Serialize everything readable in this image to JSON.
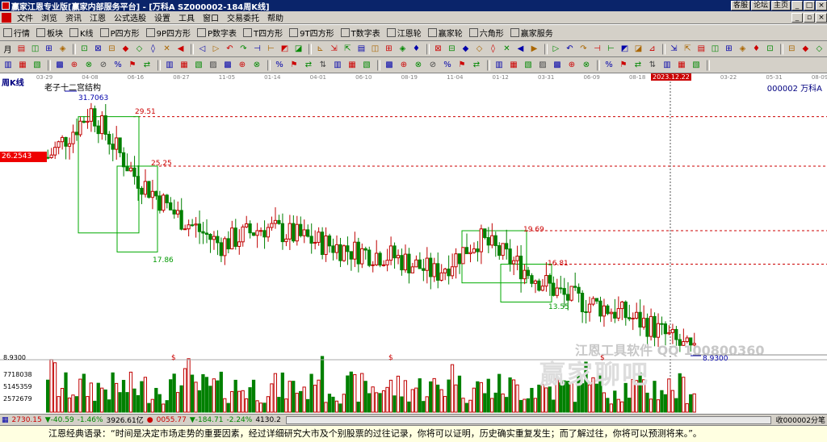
{
  "window": {
    "title": "赢家江恩专业版[赢家内部服务平台] - [万科A   SZ000002-184周K线]",
    "buttons": [
      "客服",
      "论坛",
      "主页"
    ]
  },
  "menu": [
    "文件",
    "浏览",
    "资讯",
    "江恩",
    "公式选股",
    "设置",
    "工具",
    "窗口",
    "交易委托",
    "帮助"
  ],
  "toolbar1": [
    "行情",
    "板块",
    "K线",
    "P四方形",
    "9P四方形",
    "P数字表",
    "T四方形",
    "9T四方形",
    "T数字表",
    "江恩轮",
    "赢家轮",
    "六角形",
    "赢家服务"
  ],
  "toolbar1_icons": [
    "table-icon",
    "blocks-icon",
    "kline-icon",
    "p-square-icon",
    "9p-square-icon",
    "p-number-icon",
    "t-square-icon",
    "9t-square-icon",
    "t-number-icon",
    "gann-wheel-icon",
    "winner-wheel-icon",
    "hexagon-icon",
    "service-icon"
  ],
  "toolbar2_first": "月",
  "chart": {
    "period": "周K线",
    "indicator": "老子十二宫结构",
    "code": "000002",
    "name": "万科A",
    "current_price_tag": "26.2543",
    "selected_date": "2023.12.22",
    "dates": [
      "03-29",
      "04-08",
      "06-16",
      "08-27",
      "11-05",
      "01-14",
      "04-01",
      "06-10",
      "08-19",
      "11-04",
      "01-12",
      "03-31",
      "06-09",
      "08-18",
      "11-03",
      "03-22",
      "05-31",
      "08-09"
    ],
    "levels": [
      "29.51",
      "25.25",
      "19.69",
      "16.81"
    ],
    "low_labels": [
      "17.86",
      "13.55"
    ],
    "high_label": "31.7063",
    "low_label": "8.9300",
    "axis_label": "8.9300",
    "vol_axis": [
      "7718038",
      "5145359",
      "2572679"
    ],
    "dollar": "$",
    "watermark": "江恩工具软件  QQ 100800360",
    "watermark2": "赢家聊吧"
  },
  "status": {
    "sh_index": "2730.15",
    "sh_change": "▼-40.59",
    "sh_pct": "-1.46%",
    "sh_vol": "3926.61亿",
    "sz_index": "0055.77",
    "sz_change": "▼-184.71",
    "sz_pct": "-2.24%",
    "sz_vol": "4130.2",
    "right": "收000002分笔"
  },
  "quote": "江恩经典语录：“时间是决定市场走势的重要因素，经过详细研究大市及个别股票的过往记录，你将可以证明，历史确实重复发生；而了解过往，你将可以预测将来。”。",
  "colors": {
    "up": "#c00000",
    "down": "#008000",
    "title_bg": "#0a246a",
    "toolbar_bg": "#d4d0c8"
  },
  "chart_data": {
    "type": "candlestick",
    "x": [
      "03-29",
      "04-08",
      "06-16",
      "08-27",
      "11-05",
      "01-14",
      "04-01",
      "06-10",
      "08-19",
      "11-04",
      "01-12",
      "03-31",
      "06-09",
      "08-18",
      "11-03",
      "2023.12.22"
    ],
    "close": [
      26.0,
      30.0,
      24.5,
      21.0,
      18.5,
      20.0,
      19.0,
      18.0,
      17.5,
      16.0,
      19.0,
      16.5,
      14.0,
      13.0,
      11.5,
      9.0
    ],
    "ylim": [
      8.93,
      31.7063
    ],
    "levels": [
      29.51,
      25.25,
      19.69,
      16.81
    ]
  }
}
